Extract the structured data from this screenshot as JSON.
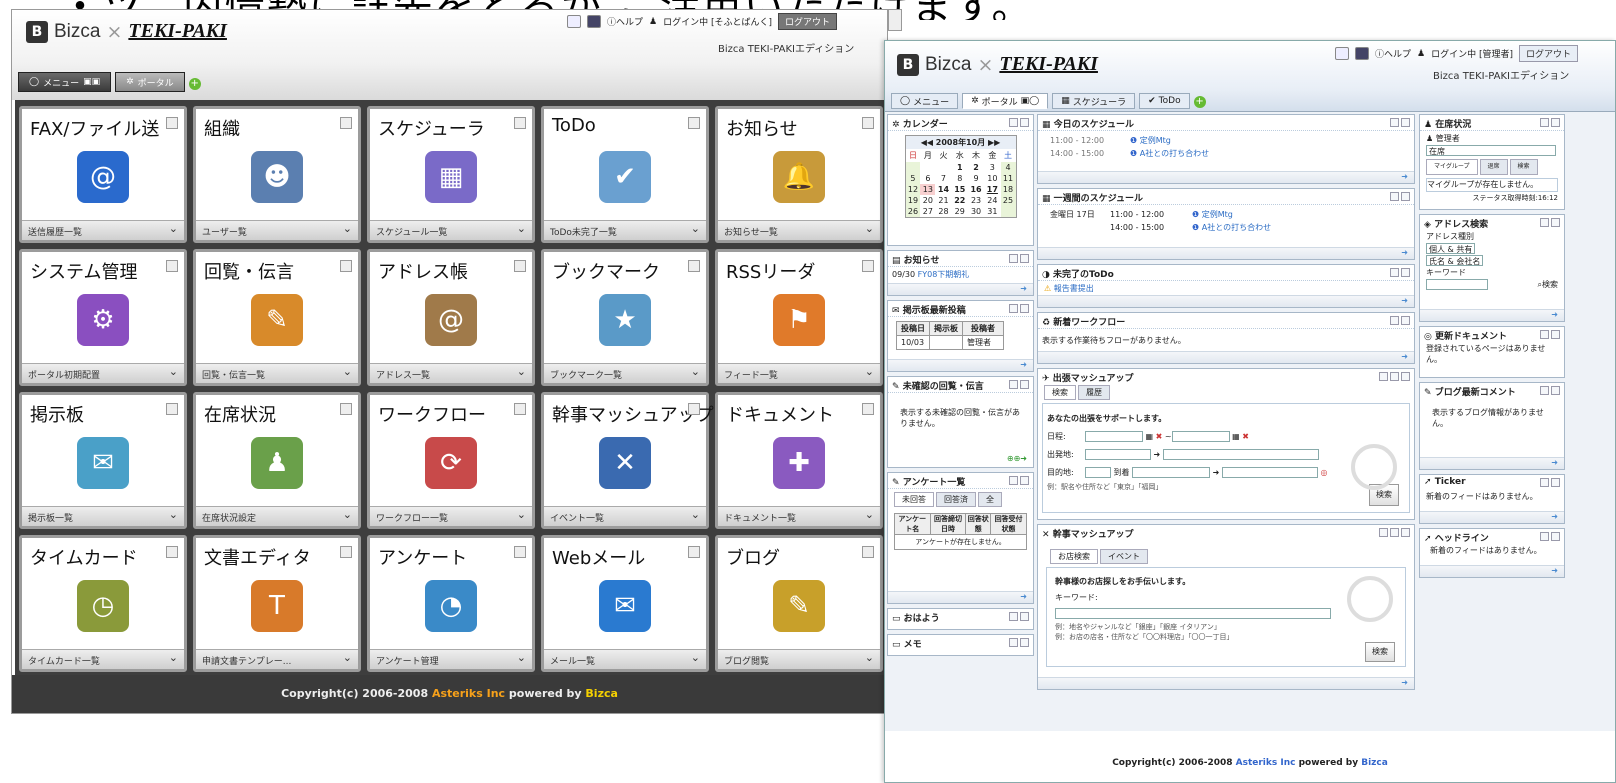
{
  "banner_text": "・ツ、内情勢に詳先をとるか ご活用いただけます。",
  "left": {
    "logo_bizca": "Bizca",
    "logo_x": "×",
    "logo_teki": "TEKI-PAKI",
    "login_text": "ログイン中 [そふとばんく]",
    "help": "ヘルプ",
    "logout": "ログアウト",
    "edition": "Bizca TEKI-PAKIエディション",
    "tabs": [
      "メニュー",
      "ポータル"
    ],
    "tiles": [
      {
        "title": "FAX/ファイル送",
        "bar": "送信履歴一覧",
        "icon": "@",
        "color": "#2a6acd"
      },
      {
        "title": "組織",
        "bar": "ユーザー覧",
        "icon": "☻",
        "color": "#5b7fb0"
      },
      {
        "title": "スケジューラ",
        "bar": "スケジュール一覧",
        "icon": "▦",
        "color": "#7a6ac8"
      },
      {
        "title": "ToDo",
        "bar": "ToDo未完了一覧",
        "icon": "✔",
        "color": "#6aa0d0"
      },
      {
        "title": "お知らせ",
        "bar": "お知らせ一覧",
        "icon": "🔔",
        "color": "#c89a3a"
      },
      {
        "title": "システム管理",
        "bar": "ポータル初期配置",
        "icon": "⚙",
        "color": "#8a4fc0"
      },
      {
        "title": "回覧・伝言",
        "bar": "回覧・伝言一覧",
        "icon": "✎",
        "color": "#d88a2a"
      },
      {
        "title": "アドレス帳",
        "bar": "アドレス一覧",
        "icon": "@",
        "color": "#a07a4a"
      },
      {
        "title": "ブックマーク",
        "bar": "ブックマーク一覧",
        "icon": "★",
        "color": "#5a9ac8"
      },
      {
        "title": "RSSリーダ",
        "bar": "フィード一覧",
        "icon": "⚑",
        "color": "#e07a2a"
      },
      {
        "title": "掲示板",
        "bar": "掲示板一覧",
        "icon": "✉",
        "color": "#4aa0c8"
      },
      {
        "title": "在席状況",
        "bar": "在席状況設定",
        "icon": "♟",
        "color": "#6aa04a"
      },
      {
        "title": "ワークフロー",
        "bar": "ワークフロー一覧",
        "icon": "⟳",
        "color": "#c84a4a"
      },
      {
        "title": "幹事マッシュアップ",
        "bar": "イベント一覧",
        "icon": "✕",
        "color": "#3a6ab0"
      },
      {
        "title": "ドキュメント",
        "bar": "ドキュメント一覧",
        "icon": "✚",
        "color": "#8a5ac0"
      },
      {
        "title": "タイムカード",
        "bar": "タイムカード一覧",
        "icon": "◷",
        "color": "#8a9a3a"
      },
      {
        "title": "文書エディタ",
        "bar": "申請文書テンプレー...",
        "icon": "T",
        "color": "#d87a2a"
      },
      {
        "title": "アンケート",
        "bar": "アンケート管理",
        "icon": "◔",
        "color": "#3a8ac8"
      },
      {
        "title": "Webメール",
        "bar": "メール一覧",
        "icon": "✉",
        "color": "#2a7ad0"
      },
      {
        "title": "ブログ",
        "bar": "ブログ閲覧",
        "icon": "✎",
        "color": "#c8a02a"
      }
    ],
    "footer": {
      "pre": "Copyright(c) 2006-2008 ",
      "a": "Asteriks",
      "b": " Inc",
      "mid": " powered by ",
      "c": "Bizca"
    }
  },
  "right": {
    "login_text": "ログイン中 [管理者]",
    "help": "ヘルプ",
    "logout": "ログアウト",
    "edition": "Bizca TEKI-PAKIエディション",
    "tabs": [
      "メニュー",
      "ポータル",
      "スケジューラ",
      "ToDo"
    ],
    "calendar": {
      "title": "カレンダー",
      "month": "2008年10月",
      "days": [
        "日",
        "月",
        "火",
        "水",
        "木",
        "金",
        "土"
      ],
      "rows": [
        [
          "",
          "",
          "",
          "1",
          "2",
          "3",
          "4"
        ],
        [
          "5",
          "6",
          "7",
          "8",
          "9",
          "10",
          "11"
        ],
        [
          "12",
          "13",
          "14",
          "15",
          "16",
          "17",
          "18"
        ],
        [
          "19",
          "20",
          "21",
          "22",
          "23",
          "24",
          "25"
        ],
        [
          "26",
          "27",
          "28",
          "29",
          "30",
          "31",
          ""
        ]
      ]
    },
    "news": {
      "title": "お知らせ",
      "date": "09/30",
      "item": "FY08下期朝礼"
    },
    "bbs": {
      "title": "掲示板最新投稿",
      "cols": [
        "投稿日",
        "掲示板",
        "投稿者"
      ],
      "row": [
        "10/03",
        "",
        "管理者"
      ]
    },
    "circ": {
      "title": "未確認の回覧・伝言",
      "msg": "表示する未確認の回覧・伝言がありません。"
    },
    "enq": {
      "title": "アンケート一覧",
      "tabs": [
        "未回答",
        "回答済",
        "全"
      ],
      "cols": [
        "アンケート名",
        "回答締切日時",
        "回答状態",
        "回答受付状態"
      ],
      "msg": "アンケートが存在しません。"
    },
    "ohayo": "おはよう",
    "memo": "メモ",
    "today": {
      "title": "今日のスケジュール",
      "items": [
        {
          "time": "11:00 - 12:00",
          "text": "定例Mtg"
        },
        {
          "time": "14:00 - 15:00",
          "text": "A社との打ち合わせ"
        }
      ]
    },
    "week": {
      "title": "一週間のスケジュール",
      "day": "金曜日 17日",
      "items": [
        {
          "time": "11:00 - 12:00",
          "text": "定例Mtg"
        },
        {
          "time": "14:00 - 15:00",
          "text": "A社との打ち合わせ"
        }
      ]
    },
    "todo": {
      "title": "未完了のToDo",
      "item": "報告書提出"
    },
    "wf": {
      "title": "新着ワークフロー",
      "msg": "表示する作業待ちフローがありません。"
    },
    "trip": {
      "title": "出張マッシュアップ",
      "tabs": [
        "検索",
        "履歴"
      ],
      "lead": "あなたの出張をサポートします。",
      "date": "日程:",
      "from": "出発地:",
      "to": "目的地:",
      "arrive": "到着",
      "hint": "例：駅名や住所など「東京」「福岡」",
      "btn": "検索"
    },
    "kanji": {
      "title": "幹事マッシュアップ",
      "tabs": [
        "お店検索",
        "イベント"
      ],
      "lead": "幹事様のお店探しをお手伝いします。",
      "kw": "キーワード:",
      "hint1": "例：地名やジャンルなど「銀座」「銀座 イタリアン」",
      "hint2": "例：お店の店名・住所など「〇〇料理店」「〇〇一丁目」",
      "btn": "検索"
    },
    "presence": {
      "title": "在席状況",
      "user": "管理者",
      "status": "在席",
      "tabs": [
        "マイグループ",
        "退席",
        "検索"
      ],
      "msg": "マイグループが存在しません。",
      "time": "ステータス取得時刻:16:12"
    },
    "addr": {
      "title": "アドレス検索",
      "label": "アドレス種別",
      "sel1": "個人 & 共有",
      "sel2": "氏名 & 会社名",
      "kw": "キーワード",
      "btn": "検索"
    },
    "docs": {
      "title": "更新ドキュメント",
      "msg": "登録されているページはありません。"
    },
    "blog": {
      "title": "ブログ最新コメント",
      "msg": "表示するブログ情報がありません。"
    },
    "ticker": {
      "title": "Ticker",
      "msg": "新着のフィードはありません。"
    },
    "headline": {
      "title": "ヘッドライン",
      "msg": "新着のフィードはありません。"
    },
    "footer": {
      "pre": "Copyright(c) 2006-2008 ",
      "a": "Asteriks",
      "b": " Inc",
      "mid": " powered by ",
      "c": "Bizca"
    }
  }
}
